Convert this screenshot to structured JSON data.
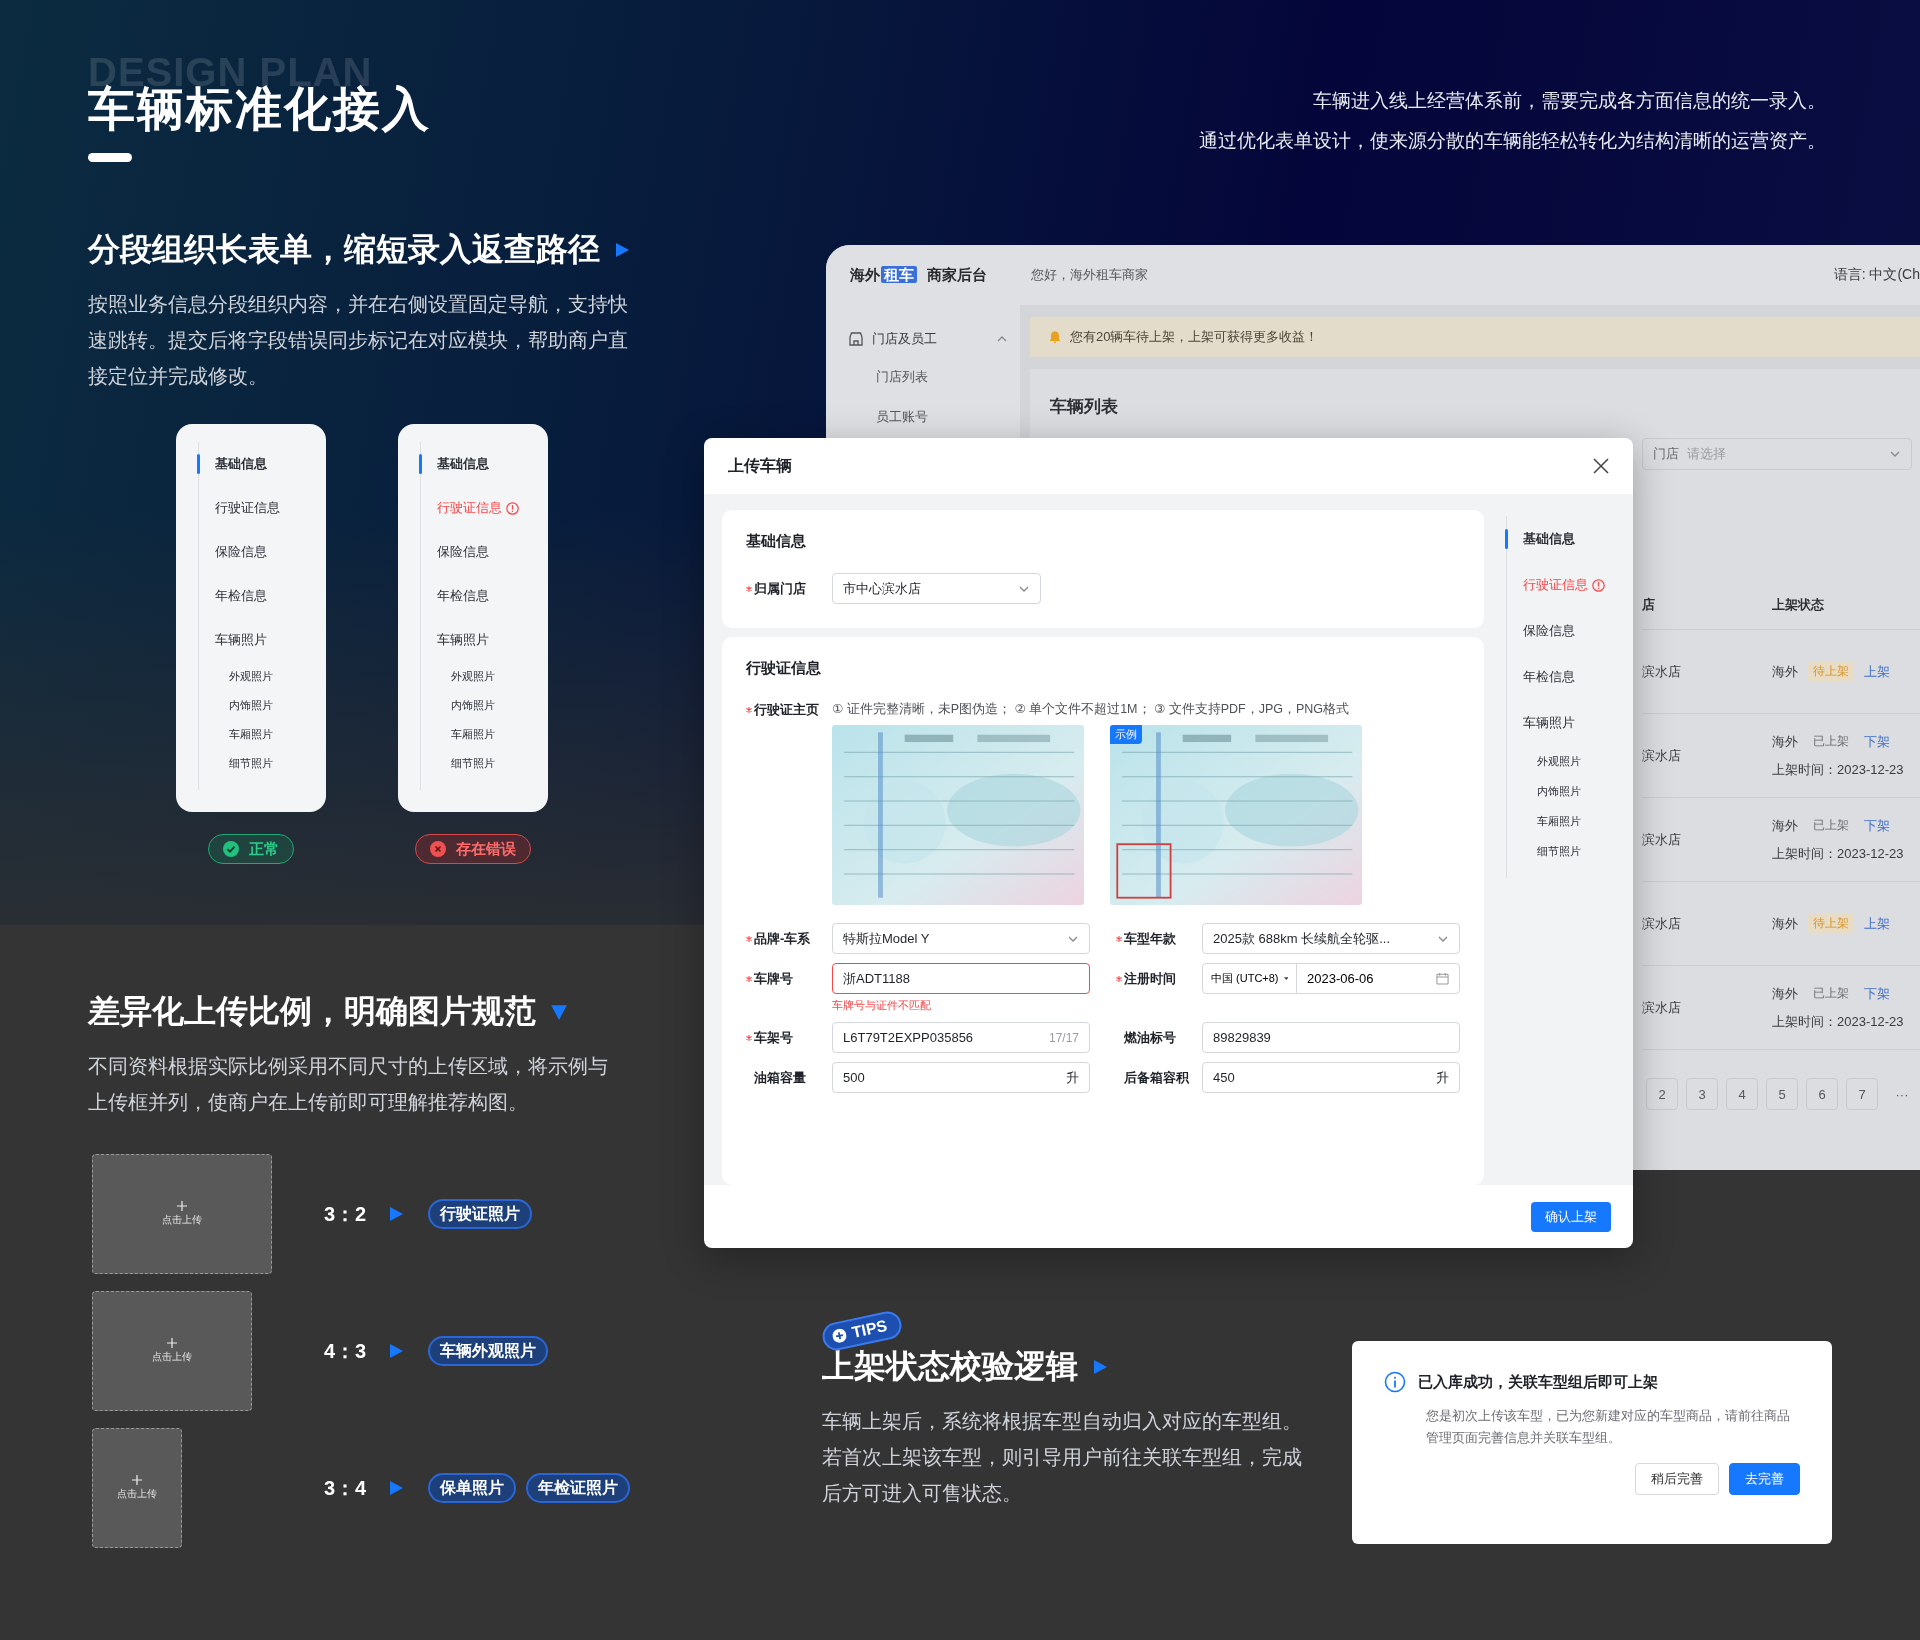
{
  "header": {
    "watermark": "DESIGN PLAN",
    "title": "车辆标准化接入",
    "intro": [
      "车辆进入线上经营体系前，需要完成各方面信息的统一录入。",
      "通过优化表单设计，使来源分散的车辆能轻松转化为结构清晰的运营资产。"
    ]
  },
  "section1": {
    "title": "分段组织长表单，缩短录入返查路径",
    "description": "按照业务信息分段组织内容，并在右侧设置固定导航，支持快速跳转。提交后将字段错误同步标记在对应模块，帮助商户直接定位并完成修改。",
    "nav_examples": [
      {
        "items": [
          {
            "label": "基础信息",
            "active": true,
            "error": false
          },
          {
            "label": "行驶证信息",
            "active": false,
            "error": false
          },
          {
            "label": "保险信息",
            "active": false,
            "error": false
          },
          {
            "label": "年检信息",
            "active": false,
            "error": false
          },
          {
            "label": "车辆照片",
            "active": false,
            "error": false,
            "children": [
              {
                "label": "外观照片"
              },
              {
                "label": "内饰照片"
              },
              {
                "label": "车厢照片"
              },
              {
                "label": "细节照片"
              }
            ]
          }
        ],
        "status": {
          "label": "正常",
          "kind": "ok"
        }
      },
      {
        "items": [
          {
            "label": "基础信息",
            "active": true,
            "error": false
          },
          {
            "label": "行驶证信息",
            "active": false,
            "error": true
          },
          {
            "label": "保险信息",
            "active": false,
            "error": false
          },
          {
            "label": "年检信息",
            "active": false,
            "error": false
          },
          {
            "label": "车辆照片",
            "active": false,
            "error": false,
            "children": [
              {
                "label": "外观照片"
              },
              {
                "label": "内饰照片"
              },
              {
                "label": "车厢照片"
              },
              {
                "label": "细节照片"
              }
            ]
          }
        ],
        "status": {
          "label": "存在错误",
          "kind": "error"
        }
      }
    ]
  },
  "admin": {
    "brand": {
      "prefix": "海外",
      "badge": "租车",
      "name": "商家后台"
    },
    "greeting": "您好，海外租车商家",
    "language": "语言: 中文(Ch",
    "sidebar": [
      {
        "label": "门店及员工",
        "expanded": true,
        "children": [
          "门店列表",
          "员工账号"
        ]
      }
    ],
    "notice": "您有20辆车待上架，上架可获得更多收益！",
    "page_title": "车辆列表",
    "filter": {
      "label": "门店",
      "placeholder": "请选择"
    },
    "table": {
      "columns": [
        "店",
        "上架状态"
      ],
      "rows": [
        {
          "store": "滨水店",
          "region": "海外",
          "status": "待上架",
          "listed": false,
          "action": "上架"
        },
        {
          "store": "滨水店",
          "region": "海外",
          "status": "已上架",
          "listed": true,
          "action": "下架",
          "time": "上架时间：2023-12-23"
        },
        {
          "store": "滨水店",
          "region": "海外",
          "status": "已上架",
          "listed": true,
          "action": "下架",
          "time": "上架时间：2023-12-23"
        },
        {
          "store": "滨水店",
          "region": "海外",
          "status": "待上架",
          "listed": false,
          "action": "上架"
        },
        {
          "store": "滨水店",
          "region": "海外",
          "status": "已上架",
          "listed": true,
          "action": "下架",
          "time": "上架时间：2023-12-23"
        }
      ]
    },
    "pagination": [
      "2",
      "3",
      "4",
      "5",
      "6",
      "7",
      "···"
    ]
  },
  "modal": {
    "title": "上传车辆",
    "basic": {
      "title": "基础信息",
      "store": {
        "label": "归属门店",
        "required": true,
        "value": "市中心滨水店"
      }
    },
    "license": {
      "title": "行驶证信息",
      "main_page": {
        "label": "行驶证主页",
        "required": true,
        "hint": "① 证件完整清晰，未P图伪造；  ② 单个文件不超过1M；  ③ 文件支持PDF，JPG，PNG格式",
        "images": [
          {
            "kind": "picture"
          },
          {
            "kind": "picture",
            "badge": "示例"
          }
        ]
      },
      "fields": [
        {
          "label": "品牌-车系",
          "required": true,
          "kind": "select",
          "value": "特斯拉Model Y"
        },
        {
          "label": "车型年款",
          "required": true,
          "kind": "select",
          "value": "2025款 688km 长续航全轮驱..."
        },
        {
          "label": "车牌号",
          "required": true,
          "kind": "input",
          "value": "浙ADT1188",
          "error": "车牌号与证件不匹配"
        },
        {
          "label": "注册时间",
          "required": true,
          "kind": "datetime",
          "timezone": "中国 (UTC+8)",
          "value": "2023-06-06"
        },
        {
          "label": "车架号",
          "required": true,
          "kind": "input",
          "value": "L6T79T2EXPP035856",
          "counter": "17/17"
        },
        {
          "label": "燃油标号",
          "required": false,
          "kind": "input",
          "value": "89829839"
        },
        {
          "label": "油箱容量",
          "required": false,
          "kind": "input",
          "value": "500",
          "suffix": "升"
        },
        {
          "label": "后备箱容积",
          "required": false,
          "kind": "input",
          "value": "450",
          "suffix": "升"
        }
      ]
    },
    "nav": [
      {
        "label": "基础信息",
        "active": true,
        "error": false
      },
      {
        "label": "行驶证信息",
        "active": false,
        "error": true
      },
      {
        "label": "保险信息",
        "active": false,
        "error": false
      },
      {
        "label": "年检信息",
        "active": false,
        "error": false
      },
      {
        "label": "车辆照片",
        "active": false,
        "error": false,
        "children": [
          {
            "label": "外观照片"
          },
          {
            "label": "内饰照片"
          },
          {
            "label": "车厢照片"
          },
          {
            "label": "细节照片"
          }
        ]
      }
    ],
    "confirm": "确认上架"
  },
  "section2": {
    "title": "差异化上传比例，明确图片规范",
    "description": "不同资料根据实际比例采用不同尺寸的上传区域，将示例与上传框并列，使商户在上传前即可理解推荐构图。",
    "ratios": [
      {
        "ratio": "3：2",
        "upload": "点击上传",
        "tags": [
          "行驶证照片"
        ]
      },
      {
        "ratio": "4：3",
        "upload": "点击上传",
        "tags": [
          "车辆外观照片"
        ]
      },
      {
        "ratio": "3：4",
        "upload": "点击上传",
        "tags": [
          "保单照片",
          "年检证照片"
        ]
      }
    ]
  },
  "section3": {
    "badge": "TIPS",
    "title": "上架状态校验逻辑",
    "description": "车辆上架后，系统将根据车型自动归入对应的车型组。若首次上架该车型，则引导用户前往关联车型组，完成后方可进入可售状态。"
  },
  "dialog": {
    "title": "已入库成功，关联车型组后即可上架",
    "body": "您是初次上传该车型，已为您新建对应的车型商品，请前往商品管理页面完善信息并关联车型组。",
    "buttons": [
      {
        "label": "稍后完善",
        "primary": false
      },
      {
        "label": "去完善",
        "primary": true
      }
    ]
  }
}
